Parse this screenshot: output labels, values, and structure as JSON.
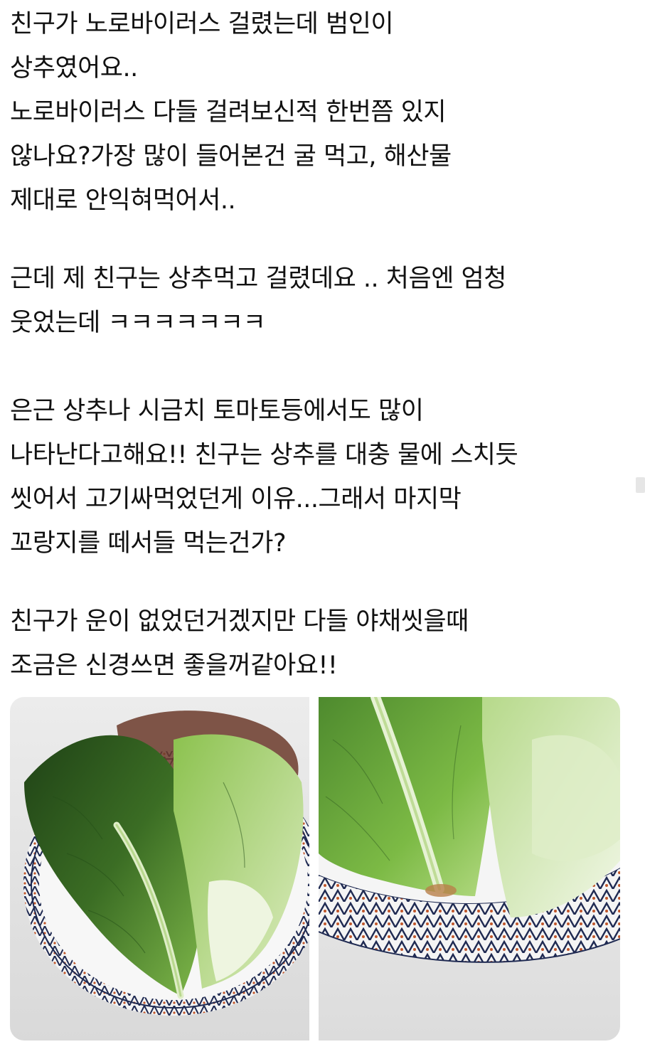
{
  "post": {
    "paragraphs": [
      {
        "lines": [
          "친구가 노로바이러스 걸렸는데 범인이",
          "상추였어요..",
          "노로바이러스 다들 걸려보신적 한번쯤 있지",
          "않나요?가장 많이 들어본건 굴 먹고, 해산물",
          "제대로 안익혀먹어서.."
        ]
      },
      {
        "lines": [
          "근데 제 친구는 상추먹고 걸렸데요 .. 처음엔 엄청",
          "웃었는데 ㅋㅋㅋㅋㅋㅋㅋ"
        ]
      },
      {
        "lines": [
          "은근 상추나 시금치 토마토등에서도 많이",
          "나타난다고해요!! 친구는 상추를 대충 물에 스치듯",
          "씻어서 고기싸먹었던게 이유...그래서 마지막",
          "꼬랑지를 떼서들 먹는건가?"
        ]
      },
      {
        "lines": [
          "친구가 운이 없었던거겠지만 다들 야채씻을때",
          "조금은 신경쓰면 좋을꺼같아요!!"
        ]
      }
    ]
  },
  "media": {
    "photos": [
      {
        "subject": "lettuce-on-plate-full"
      },
      {
        "subject": "lettuce-on-plate-closeup"
      }
    ]
  },
  "colors": {
    "text": "#111111",
    "background": "#ffffff",
    "lettuce_dark": "#2f5a1f",
    "lettuce_light": "#9fcf5a",
    "plate_rim": "#1f2a52"
  }
}
